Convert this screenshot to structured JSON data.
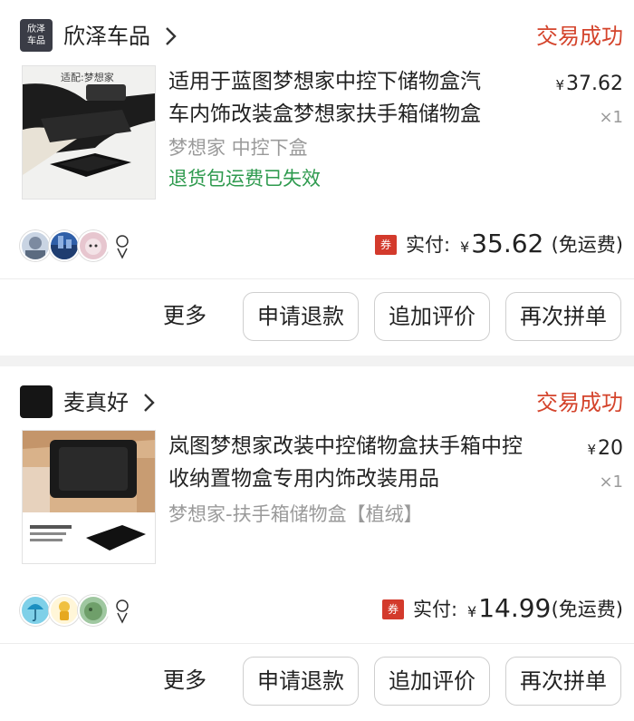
{
  "orders": [
    {
      "shop_icon_text": [
        "欣泽",
        "车品"
      ],
      "shop_name": "欣泽车品",
      "status": "交易成功",
      "thumb_caption": "适配:梦想家",
      "title_lines": [
        "适用于蓝图梦想家中控下储物盒汽",
        "车内饰改装盒梦想家扶手箱储物盒"
      ],
      "spec": "梦想家 中控下盒",
      "note": "退货包运费已失效",
      "currency": "¥",
      "price": "37.62",
      "qty": "×1",
      "coupon": "券",
      "pay_label": "实付:",
      "pay_amount": "35.62",
      "pay_note": "(免运费)",
      "more": "更多",
      "buttons": [
        "申请退款",
        "追加评价",
        "再次拼单"
      ]
    },
    {
      "shop_icon_text": [
        "",
        ""
      ],
      "shop_name": "麦真好",
      "status": "交易成功",
      "thumb_caption": "",
      "title_lines": [
        "岚图梦想家改装中控储物盒扶手箱中控",
        "收纳置物盒专用内饰改装用品"
      ],
      "spec": "梦想家-扶手箱储物盒【植绒】",
      "note": "",
      "currency": "¥",
      "price": "20",
      "qty": "×1",
      "coupon": "券",
      "pay_label": "实付:",
      "pay_amount": "14.99",
      "pay_note": "(免运费)",
      "more": "更多",
      "buttons": [
        "申请退款",
        "追加评价",
        "再次拼单"
      ]
    }
  ],
  "colors": {
    "status_red": "#d4442c",
    "note_green": "#2e9a4e",
    "coupon_red": "#d33a2c"
  },
  "icons": [
    "shop-logo-icon",
    "chevron-right-icon",
    "coupon-icon",
    "buyer-avatar-icon"
  ]
}
